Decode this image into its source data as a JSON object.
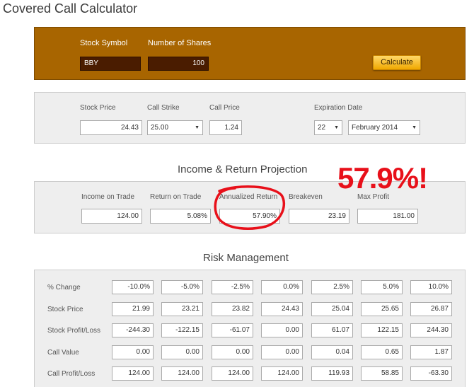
{
  "app": {
    "title": "Covered Call Calculator"
  },
  "position": {
    "stock_symbol_label": "Stock Symbol",
    "stock_symbol_value": "BBY",
    "shares_label": "Number of Shares",
    "shares_value": "100",
    "calculate_label": "Calculate"
  },
  "option": {
    "stock_price_label": "Stock Price",
    "stock_price_value": "24.43",
    "call_strike_label": "Call Strike",
    "call_strike_value": "25.00",
    "call_price_label": "Call Price",
    "call_price_value": "1.24",
    "expiration_label": "Expiration Date",
    "exp_day_value": "22",
    "exp_month_value": "February 2014"
  },
  "projection": {
    "title": "Income & Return Projection",
    "fields": [
      {
        "label": "Income on Trade",
        "value": "124.00"
      },
      {
        "label": "Return on Trade",
        "value": "5.08%"
      },
      {
        "label": "Annualized Return",
        "value": "57.90%"
      },
      {
        "label": "Breakeven",
        "value": "23.19"
      },
      {
        "label": "Max Profit",
        "value": "181.00"
      }
    ]
  },
  "annotation": {
    "text": "57.9%!",
    "color": "#e8101a"
  },
  "risk": {
    "title": "Risk Management",
    "rows": [
      {
        "label": "% Change",
        "values": [
          "-10.0%",
          "-5.0%",
          "-2.5%",
          "0.0%",
          "2.5%",
          "5.0%",
          "10.0%"
        ]
      },
      {
        "label": "Stock Price",
        "values": [
          "21.99",
          "23.21",
          "23.82",
          "24.43",
          "25.04",
          "25.65",
          "26.87"
        ]
      },
      {
        "label": "Stock Profit/Loss",
        "values": [
          "-244.30",
          "-122.15",
          "-61.07",
          "0.00",
          "61.07",
          "122.15",
          "244.30"
        ]
      },
      {
        "label": "Call Value",
        "values": [
          "0.00",
          "0.00",
          "0.00",
          "0.00",
          "0.04",
          "0.65",
          "1.87"
        ]
      },
      {
        "label": "Call Profit/Loss",
        "values": [
          "124.00",
          "124.00",
          "124.00",
          "124.00",
          "119.93",
          "58.85",
          "-63.30"
        ]
      }
    ]
  },
  "colors": {
    "brand_panel": "#a86500",
    "input_dark": "#4a1c00",
    "button": "#f0a800"
  }
}
